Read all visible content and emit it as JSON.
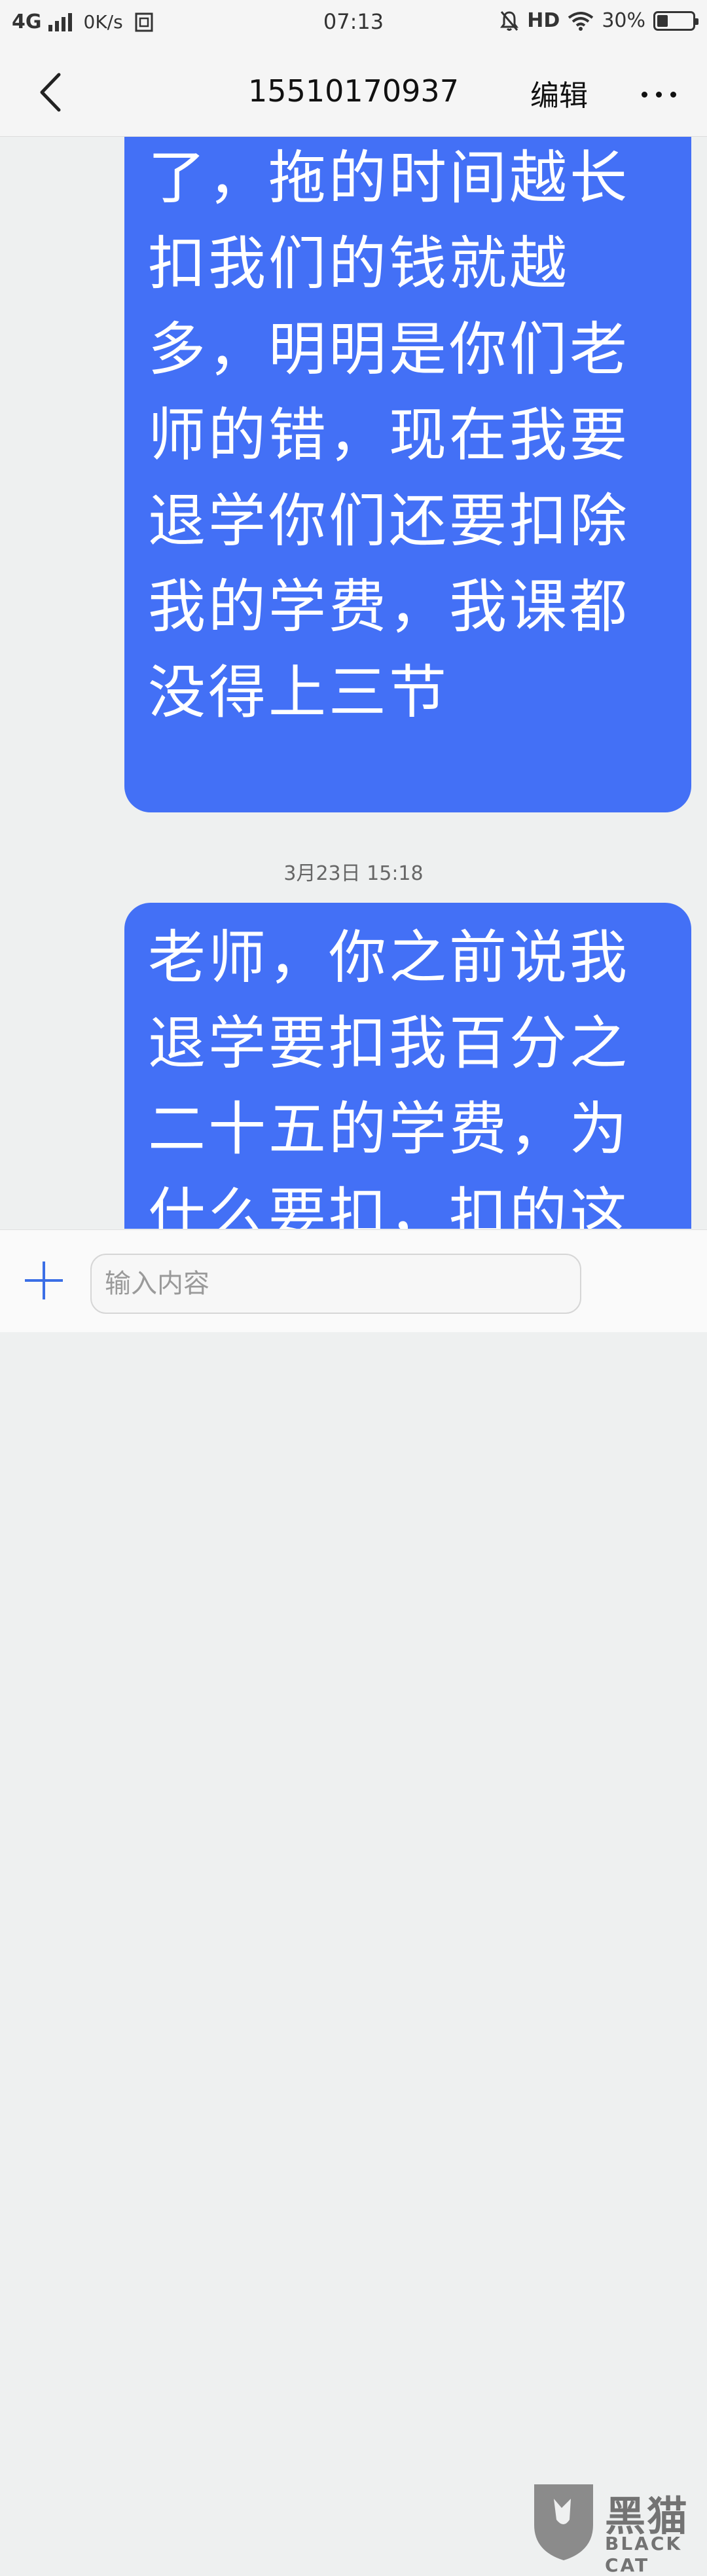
{
  "status_bar": {
    "network": "4G",
    "speed": "0K/s",
    "time": "07:13",
    "hd": "HD",
    "battery": "30%",
    "battery_level": 0.3
  },
  "header": {
    "title": "15510170937",
    "edit_label": "编辑"
  },
  "messages": [
    {
      "text": "延时间么，那么久了，拖的时间越长扣我们的钱就越多，明明是你们老师的错，现在我要退学你们还要扣除我的学费，我课都没得上三节"
    },
    {
      "timestamp": "3月23日 15:18",
      "text": "老师，你之前说我退学要扣我百分之二十五的学费，为什么要扣，扣的这"
    }
  ],
  "input": {
    "placeholder": "输入内容"
  },
  "watermark": {
    "text": "黑猫",
    "subtext": "BLACK CAT"
  },
  "colors": {
    "bubble": "#4370f6",
    "accent": "#3b6fe6"
  },
  "icons": [
    "back-arrow-icon",
    "more-dots-icon",
    "plus-icon",
    "signal-icon",
    "wifi-icon",
    "bell-off-icon",
    "battery-icon"
  ]
}
